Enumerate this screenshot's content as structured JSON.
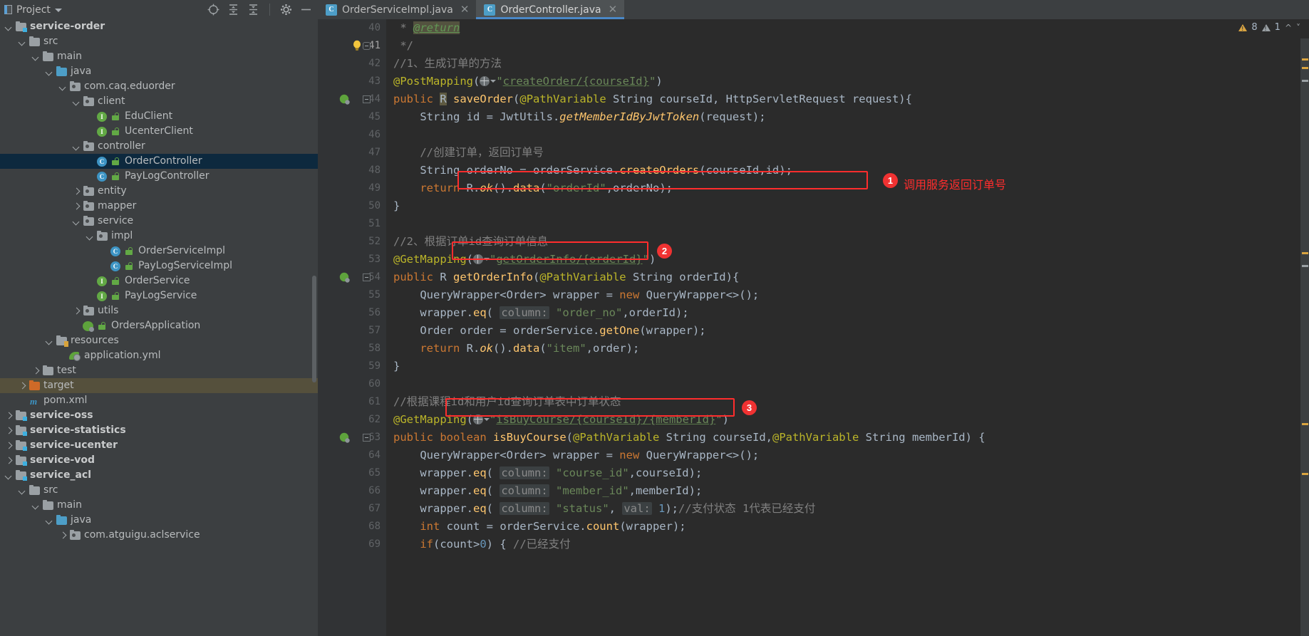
{
  "window": {
    "project_panel_title": "Project",
    "theme_bg": "#3c3f41",
    "editor_bg": "#2b2b2b",
    "accent": "#4a88c7",
    "annotation_color": "#ff2d2d"
  },
  "toolbar": {
    "icons": [
      {
        "name": "locate-icon",
        "title": "Select Opened File"
      },
      {
        "name": "expand-all-icon",
        "title": "Expand All"
      },
      {
        "name": "collapse-all-icon",
        "title": "Collapse All"
      },
      {
        "name": "gear-icon",
        "title": "Settings"
      },
      {
        "name": "hide-icon",
        "title": "Hide"
      }
    ]
  },
  "tabs": [
    {
      "label": "OrderServiceImpl.java",
      "icon": "class-icon",
      "letter": "C",
      "active": false,
      "closable": true
    },
    {
      "label": "OrderController.java",
      "icon": "class-icon",
      "letter": "C",
      "active": true,
      "closable": false
    }
  ],
  "inspection": {
    "warnings": "8",
    "weak_warnings": "1"
  },
  "tree": [
    {
      "depth": 0,
      "arrow": "dn",
      "icon": "module-folder",
      "label": "service-order",
      "bold": true,
      "state": "normal"
    },
    {
      "depth": 1,
      "arrow": "dn",
      "icon": "folder-grey",
      "label": "src",
      "bold": false,
      "state": "normal"
    },
    {
      "depth": 2,
      "arrow": "dn",
      "icon": "folder-grey",
      "label": "main",
      "bold": false,
      "state": "normal"
    },
    {
      "depth": 3,
      "arrow": "dn",
      "icon": "folder-blue",
      "label": "java",
      "bold": false,
      "state": "normal"
    },
    {
      "depth": 4,
      "arrow": "dn",
      "icon": "package-icon",
      "label": "com.caq.eduorder",
      "bold": false,
      "state": "normal"
    },
    {
      "depth": 5,
      "arrow": "dn",
      "icon": "package-icon",
      "label": "client",
      "bold": false,
      "state": "normal"
    },
    {
      "depth": 6,
      "arrow": "none",
      "icon": "interface-icon",
      "label": "EduClient",
      "bold": false,
      "state": "normal",
      "lock": true
    },
    {
      "depth": 6,
      "arrow": "none",
      "icon": "interface-icon",
      "label": "UcenterClient",
      "bold": false,
      "state": "normal",
      "lock": true
    },
    {
      "depth": 5,
      "arrow": "dn",
      "icon": "package-icon",
      "label": "controller",
      "bold": false,
      "state": "normal"
    },
    {
      "depth": 6,
      "arrow": "none",
      "icon": "class-icon",
      "label": "OrderController",
      "bold": false,
      "state": "selected",
      "lock": true
    },
    {
      "depth": 6,
      "arrow": "none",
      "icon": "class-icon",
      "label": "PayLogController",
      "bold": false,
      "state": "normal",
      "lock": true
    },
    {
      "depth": 5,
      "arrow": "rt",
      "icon": "package-icon",
      "label": "entity",
      "bold": false,
      "state": "normal"
    },
    {
      "depth": 5,
      "arrow": "rt",
      "icon": "package-icon",
      "label": "mapper",
      "bold": false,
      "state": "normal"
    },
    {
      "depth": 5,
      "arrow": "dn",
      "icon": "package-icon",
      "label": "service",
      "bold": false,
      "state": "normal"
    },
    {
      "depth": 6,
      "arrow": "dn",
      "icon": "package-icon",
      "label": "impl",
      "bold": false,
      "state": "normal"
    },
    {
      "depth": 7,
      "arrow": "none",
      "icon": "class-icon",
      "label": "OrderServiceImpl",
      "bold": false,
      "state": "normal",
      "lock": true
    },
    {
      "depth": 7,
      "arrow": "none",
      "icon": "class-icon",
      "label": "PayLogServiceImpl",
      "bold": false,
      "state": "normal",
      "lock": true
    },
    {
      "depth": 6,
      "arrow": "none",
      "icon": "interface-icon",
      "label": "OrderService",
      "bold": false,
      "state": "normal",
      "lock": true
    },
    {
      "depth": 6,
      "arrow": "none",
      "icon": "interface-icon",
      "label": "PayLogService",
      "bold": false,
      "state": "normal",
      "lock": true
    },
    {
      "depth": 5,
      "arrow": "rt",
      "icon": "package-icon",
      "label": "utils",
      "bold": false,
      "state": "normal"
    },
    {
      "depth": 5,
      "arrow": "none",
      "icon": "spring-icon",
      "label": "OrdersApplication",
      "bold": false,
      "state": "normal",
      "lock": true
    },
    {
      "depth": 3,
      "arrow": "dn",
      "icon": "resources-folder",
      "label": "resources",
      "bold": false,
      "state": "normal"
    },
    {
      "depth": 4,
      "arrow": "none",
      "icon": "yml-icon",
      "label": "application.yml",
      "bold": false,
      "state": "normal"
    },
    {
      "depth": 2,
      "arrow": "rt",
      "icon": "folder-grey",
      "label": "test",
      "bold": false,
      "state": "normal"
    },
    {
      "depth": 1,
      "arrow": "rt",
      "icon": "folder-orange",
      "label": "target",
      "bold": false,
      "state": "excluded"
    },
    {
      "depth": 1,
      "arrow": "none",
      "icon": "maven-icon",
      "label": "pom.xml",
      "bold": false,
      "state": "normal"
    },
    {
      "depth": 0,
      "arrow": "rt",
      "icon": "module-folder",
      "label": "service-oss",
      "bold": true,
      "state": "normal"
    },
    {
      "depth": 0,
      "arrow": "rt",
      "icon": "module-folder",
      "label": "service-statistics",
      "bold": true,
      "state": "normal"
    },
    {
      "depth": 0,
      "arrow": "rt",
      "icon": "module-folder",
      "label": "service-ucenter",
      "bold": true,
      "state": "normal"
    },
    {
      "depth": 0,
      "arrow": "rt",
      "icon": "module-folder",
      "label": "service-vod",
      "bold": true,
      "state": "normal"
    },
    {
      "depth": 0,
      "arrow": "dn",
      "icon": "module-folder",
      "label": "service_acl",
      "bold": true,
      "state": "normal"
    },
    {
      "depth": 1,
      "arrow": "dn",
      "icon": "folder-grey",
      "label": "src",
      "bold": false,
      "state": "normal"
    },
    {
      "depth": 2,
      "arrow": "dn",
      "icon": "folder-grey",
      "label": "main",
      "bold": false,
      "state": "normal"
    },
    {
      "depth": 3,
      "arrow": "dn",
      "icon": "folder-blue",
      "label": "java",
      "bold": false,
      "state": "normal"
    },
    {
      "depth": 4,
      "arrow": "rt",
      "icon": "package-icon",
      "label": "com.atguigu.aclservice",
      "bold": false,
      "state": "normal"
    }
  ],
  "code": {
    "first_line": 40,
    "lines": [
      {
        "n": 40,
        "text": " * @return"
      },
      {
        "n": 41,
        "text": " */",
        "bulb": true,
        "fold_cap": true
      },
      {
        "n": 42,
        "text": "//1、生成订单的方法"
      },
      {
        "n": 43,
        "text": "@PostMapping(\"createOrder/{courseId}\")"
      },
      {
        "n": 44,
        "text": "public R saveOrder(@PathVariable String courseId, HttpServletRequest request){",
        "run": true,
        "fold": true
      },
      {
        "n": 45,
        "text": "    String id = JwtUtils.getMemberIdByJwtToken(request);"
      },
      {
        "n": 46,
        "text": ""
      },
      {
        "n": 47,
        "text": "    //创建订单，返回订单号"
      },
      {
        "n": 48,
        "text": "    String orderNo = orderService.createOrders(courseId,id);"
      },
      {
        "n": 49,
        "text": "    return R.ok().data(\"orderId\",orderNo);"
      },
      {
        "n": 50,
        "text": "}"
      },
      {
        "n": 51,
        "text": ""
      },
      {
        "n": 52,
        "text": "//2、根据订单id查询订单信息"
      },
      {
        "n": 53,
        "text": "@GetMapping(\"getOrderInfo/{orderId}\")"
      },
      {
        "n": 54,
        "text": "public R getOrderInfo(@PathVariable String orderId){",
        "run": true,
        "fold": true
      },
      {
        "n": 55,
        "text": "    QueryWrapper<Order> wrapper = new QueryWrapper<>();"
      },
      {
        "n": 56,
        "text": "    wrapper.eq( column: \"order_no\",orderId);"
      },
      {
        "n": 57,
        "text": "    Order order = orderService.getOne(wrapper);"
      },
      {
        "n": 58,
        "text": "    return R.ok().data(\"item\",order);"
      },
      {
        "n": 59,
        "text": "}"
      },
      {
        "n": 60,
        "text": ""
      },
      {
        "n": 61,
        "text": "//根据课程id和用户id查询订单表中订单状态"
      },
      {
        "n": 62,
        "text": "@GetMapping(\"isBuyCourse/{courseId}/{memberId}\")"
      },
      {
        "n": 63,
        "text": "public boolean isBuyCourse(@PathVariable String courseId,@PathVariable String memberId) {",
        "run": true,
        "fold": true
      },
      {
        "n": 64,
        "text": "    QueryWrapper<Order> wrapper = new QueryWrapper<>();"
      },
      {
        "n": 65,
        "text": "    wrapper.eq( column: \"course_id\",courseId);"
      },
      {
        "n": 66,
        "text": "    wrapper.eq( column: \"member_id\",memberId);"
      },
      {
        "n": 67,
        "text": "    wrapper.eq( column: \"status\", val: 1);//支付状态 1代表已经支付"
      },
      {
        "n": 68,
        "text": "    int count = orderService.count(wrapper);"
      },
      {
        "n": 69,
        "text": "    if(count>0) { //已经支付"
      }
    ]
  },
  "annotations": [
    {
      "id": "1",
      "badge": "1",
      "text": "调用服务返回订单号"
    },
    {
      "id": "2",
      "badge": "2",
      "text": ""
    },
    {
      "id": "3",
      "badge": "3",
      "text": ""
    }
  ]
}
